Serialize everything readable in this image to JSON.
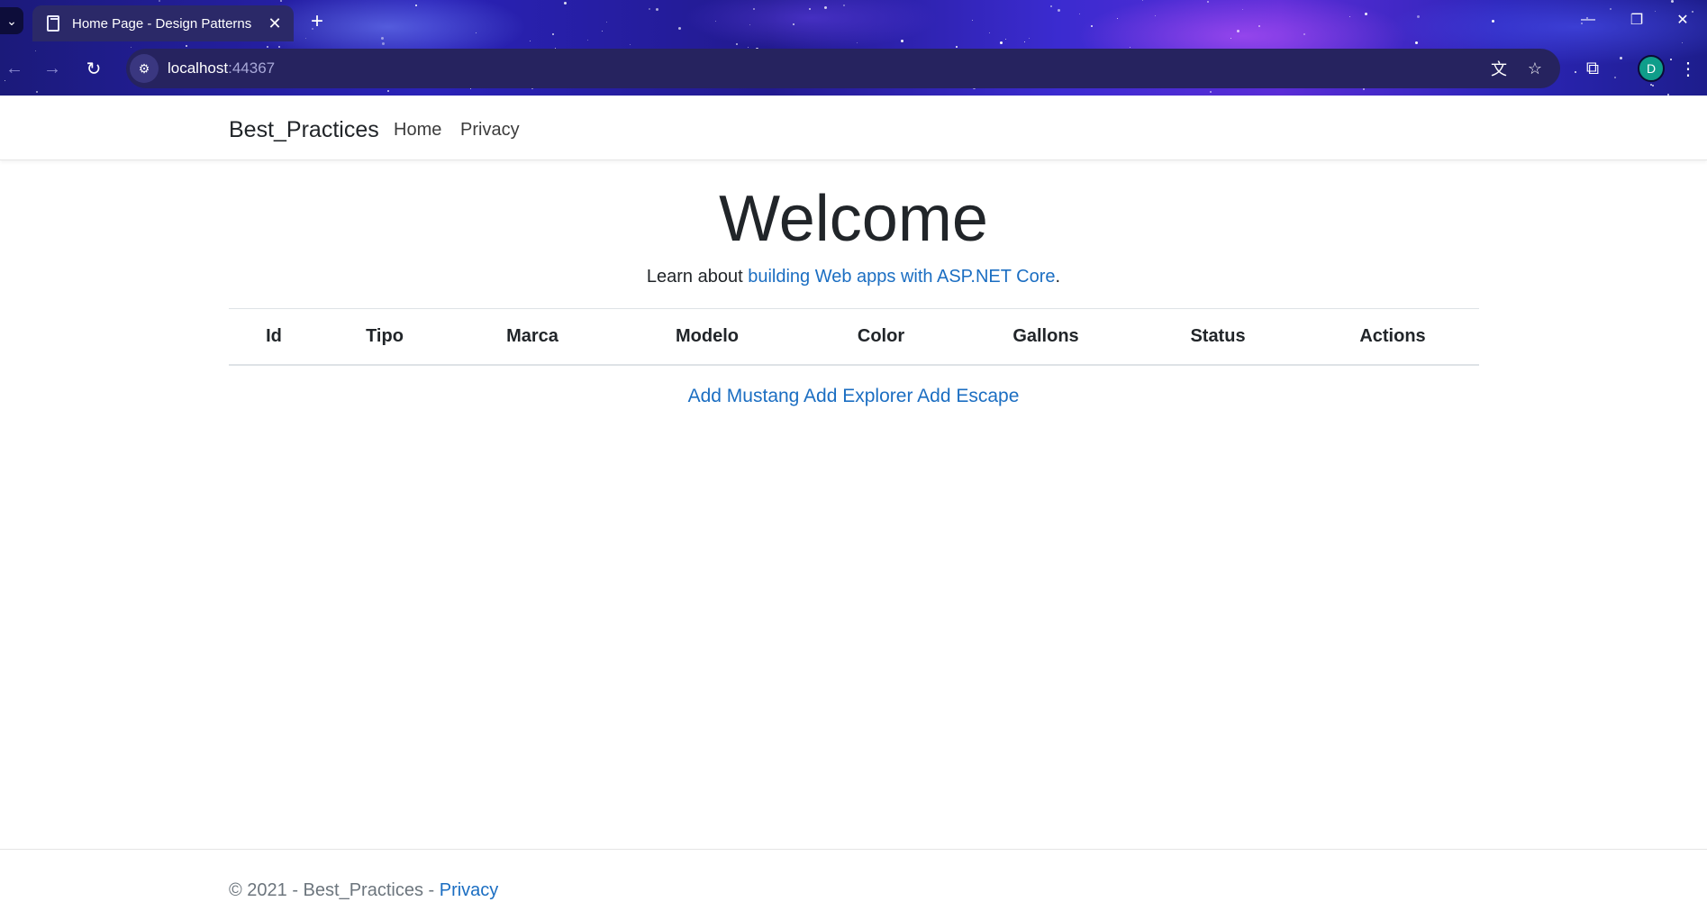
{
  "browser": {
    "tab": {
      "title": "Home Page - Design Patterns"
    },
    "address": {
      "host": "localhost",
      "port": ":44367"
    },
    "profile_initial": "D"
  },
  "site": {
    "brand": "Best_Practices",
    "nav": {
      "home": "Home",
      "privacy": "Privacy"
    }
  },
  "hero": {
    "title": "Welcome",
    "lead_prefix": "Learn about ",
    "lead_link": "building Web apps with ASP.NET Core",
    "lead_suffix": "."
  },
  "table": {
    "headers": [
      "Id",
      "Tipo",
      "Marca",
      "Modelo",
      "Color",
      "Gallons",
      "Status",
      "Actions"
    ]
  },
  "actions": {
    "add_mustang": "Add Mustang",
    "add_explorer": "Add Explorer",
    "add_escape": "Add Escape"
  },
  "footer": {
    "copyright": "© 2021 - Best_Practices - ",
    "privacy": "Privacy"
  },
  "colors": {
    "link": "#1b6ec2",
    "avatar": "#0f9d8a"
  }
}
